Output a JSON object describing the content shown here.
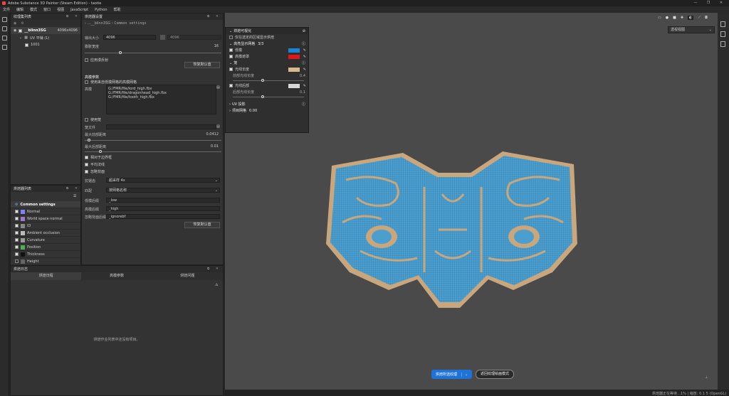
{
  "window": {
    "title": "Adobe Substance 3D Painter (Steam Edition) - taotie"
  },
  "menu": [
    "文件",
    "编辑",
    "模式",
    "窗口",
    "视图",
    "JavaScript",
    "Python",
    "帮助"
  ],
  "texture_set_panel": {
    "title": "纹理集列表",
    "set_name": "__blinn3SG",
    "set_res": "4096x4096",
    "uv_label": "UV 平铺 (1)",
    "tile": "1001"
  },
  "bake_settings_panel": {
    "title": "烘焙器设置",
    "breadcrumb_root": "__blinn3SG",
    "breadcrumb_leaf": "Common settings",
    "output_size_label": "输出大小",
    "output_size": "4096",
    "output_size_locked": "4096",
    "dilation_label": "膨胀宽度",
    "dilation_value": "16",
    "apply_diffusion": "应用漫反射",
    "reset_label": "恢复默认值",
    "highpoly_header": "高模参数",
    "use_lowpoly_as_high": "使用来自低模网格的高模网格",
    "mesh_label": "高模",
    "mesh_files": [
      "G:/FMR/file/lord_high.fbx",
      "G:/FMR/file/dragonhead_high.fbx",
      "G:/FMR/file/tooth_high.fbx"
    ],
    "use_cage": "使用笼",
    "cage_file_label": "笼文件",
    "max_front_label": "最大前部距离",
    "max_front_value": "0.0412",
    "max_rear_label": "最大后部距离",
    "max_rear_value": "0.01",
    "relative_bbox": "相对于边界框",
    "average_normals": "平均法线",
    "ignore_backface": "忽略背面",
    "antialias_label": "抗锯齿",
    "antialias_value": "超采样 4x",
    "match_label": "匹配",
    "match_value": "按网格名称",
    "low_suffix_label": "低模后缀",
    "low_suffix": "_low",
    "high_suffix_label": "高模后缀",
    "high_suffix": "_high",
    "ignore_suffix_label": "忽略背面后缀",
    "ignore_suffix": "_ignorebf",
    "reset_label2": "恢复默认值"
  },
  "baked_maps_panel": {
    "title": "烘焙器列表",
    "items": [
      {
        "label": "Common settings",
        "checked": true,
        "active": true
      },
      {
        "label": "Normal",
        "checked": true
      },
      {
        "label": "World space normal",
        "checked": true
      },
      {
        "label": "ID",
        "checked": true
      },
      {
        "label": "Ambient occlusion",
        "checked": true
      },
      {
        "label": "Curvature",
        "checked": true
      },
      {
        "label": "Position",
        "checked": true
      },
      {
        "label": "Thickness",
        "checked": true
      },
      {
        "label": "Height",
        "checked": false
      }
    ]
  },
  "bake_log_panel": {
    "title": "烘焙日志",
    "tabs": [
      "烘焙日程",
      "高模参数",
      "烘焙问题"
    ],
    "empty_text": "烘焙作业列表中还没有项目。"
  },
  "viewport": {
    "camera_select": "透视视图",
    "overlay": {
      "title": "烘焙可视化",
      "show_highpoly": "仅在选定的区域显示烘焙",
      "cage_section": "高亮显示网格",
      "cage_count": "3/3",
      "low_label": "低模",
      "high_label": "高模遮罩",
      "ray_section": "笼",
      "ray_label": "光线长度",
      "ray_sub": "前部光线长度",
      "ray_value": "0.4",
      "rear_label": "光线后部",
      "rear_sub": "后部光线长度",
      "rear_value": "0.1",
      "uv_section": "UV 投影",
      "proj_section": "项目网格",
      "proj_value": "0.00"
    },
    "bake_button": "烘焙所选纹理",
    "return_button": "返回纹理绘画模式"
  },
  "status": {
    "left": "烘焙器正在等待…",
    "right": "1% | 缩放: 0.1 5 (OpenGL)"
  },
  "colors": {
    "accent": "#1e73d8",
    "low_swatch": "#1a84d6",
    "high_swatch": "#e11616",
    "ray_swatch": "#d9b88a",
    "rear_swatch": "#d8d8d8",
    "mesh_blue": "#4a9fcf",
    "mesh_tan": "#c9a67c"
  }
}
